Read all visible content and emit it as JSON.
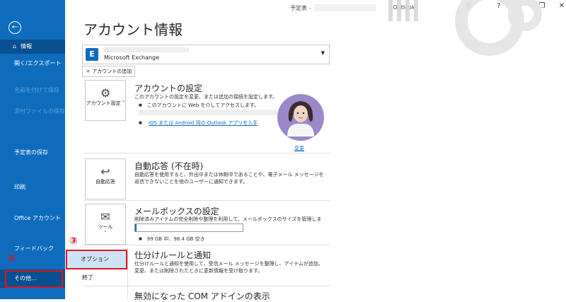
{
  "titlebar": {
    "title": "予定表 -",
    "app": "- Outlook",
    "icons": [
      "help-icon",
      "minimize-icon",
      "restore-icon",
      "close-icon"
    ]
  },
  "sidebar": {
    "items": [
      {
        "label": "情報",
        "icon": "home-icon"
      },
      {
        "label": "開く/エクスポート"
      },
      {
        "label": "名前を付けて保存"
      },
      {
        "label": "添付ファイルの保存"
      },
      {
        "label": "予定表の保存"
      },
      {
        "label": "印刷"
      },
      {
        "label": "Office アカウント"
      },
      {
        "label": "フィードバック"
      },
      {
        "label": "その他..."
      }
    ]
  },
  "annotations": {
    "step2": "②",
    "step3": "③"
  },
  "flyout": {
    "options_label": "オプション",
    "exit_label": "終了"
  },
  "main": {
    "heading": "アカウント情報",
    "account_type": "Microsoft Exchange",
    "add_account_label": "アカウントの追加",
    "account_settings": {
      "tile_label": "アカウント設定",
      "title": "アカウントの設定",
      "desc": "このアカウントの設定を変更、または追加の接続を設定します。",
      "bullet1": "このアカウントに Web を介してアクセスします。",
      "link": "iOS または Android 用の Outlook アプリを入手",
      "change_label": "変更"
    },
    "auto_reply": {
      "tile_label": "自動応答",
      "title": "自動応答 (不在時)",
      "desc": "自動応答を使用すると、外出中または休暇中であることや、電子メール メッセージを返信できないことを他のユーザーに通知できます。"
    },
    "mailbox": {
      "tile_label": "ツール",
      "title": "メールボックスの設定",
      "desc": "削除済みアイテムの完全削除や整理を利用して、メールボックスのサイズを管理します。",
      "usage": "99 GB 中、98.4 GB 空き",
      "used_fraction": 0.006
    },
    "rules": {
      "title": "仕分けルールと通知",
      "desc": "仕分けルールと通知を使用して、受信メール メッセージを整理し、アイテムが追加、変更、または削除されたときに更新情報を受け取ります。"
    },
    "com": {
      "title": "無効になった COM アドインの表示"
    }
  },
  "colors": {
    "sidebar": "#0f6cbd",
    "annotation": "#d71921"
  }
}
